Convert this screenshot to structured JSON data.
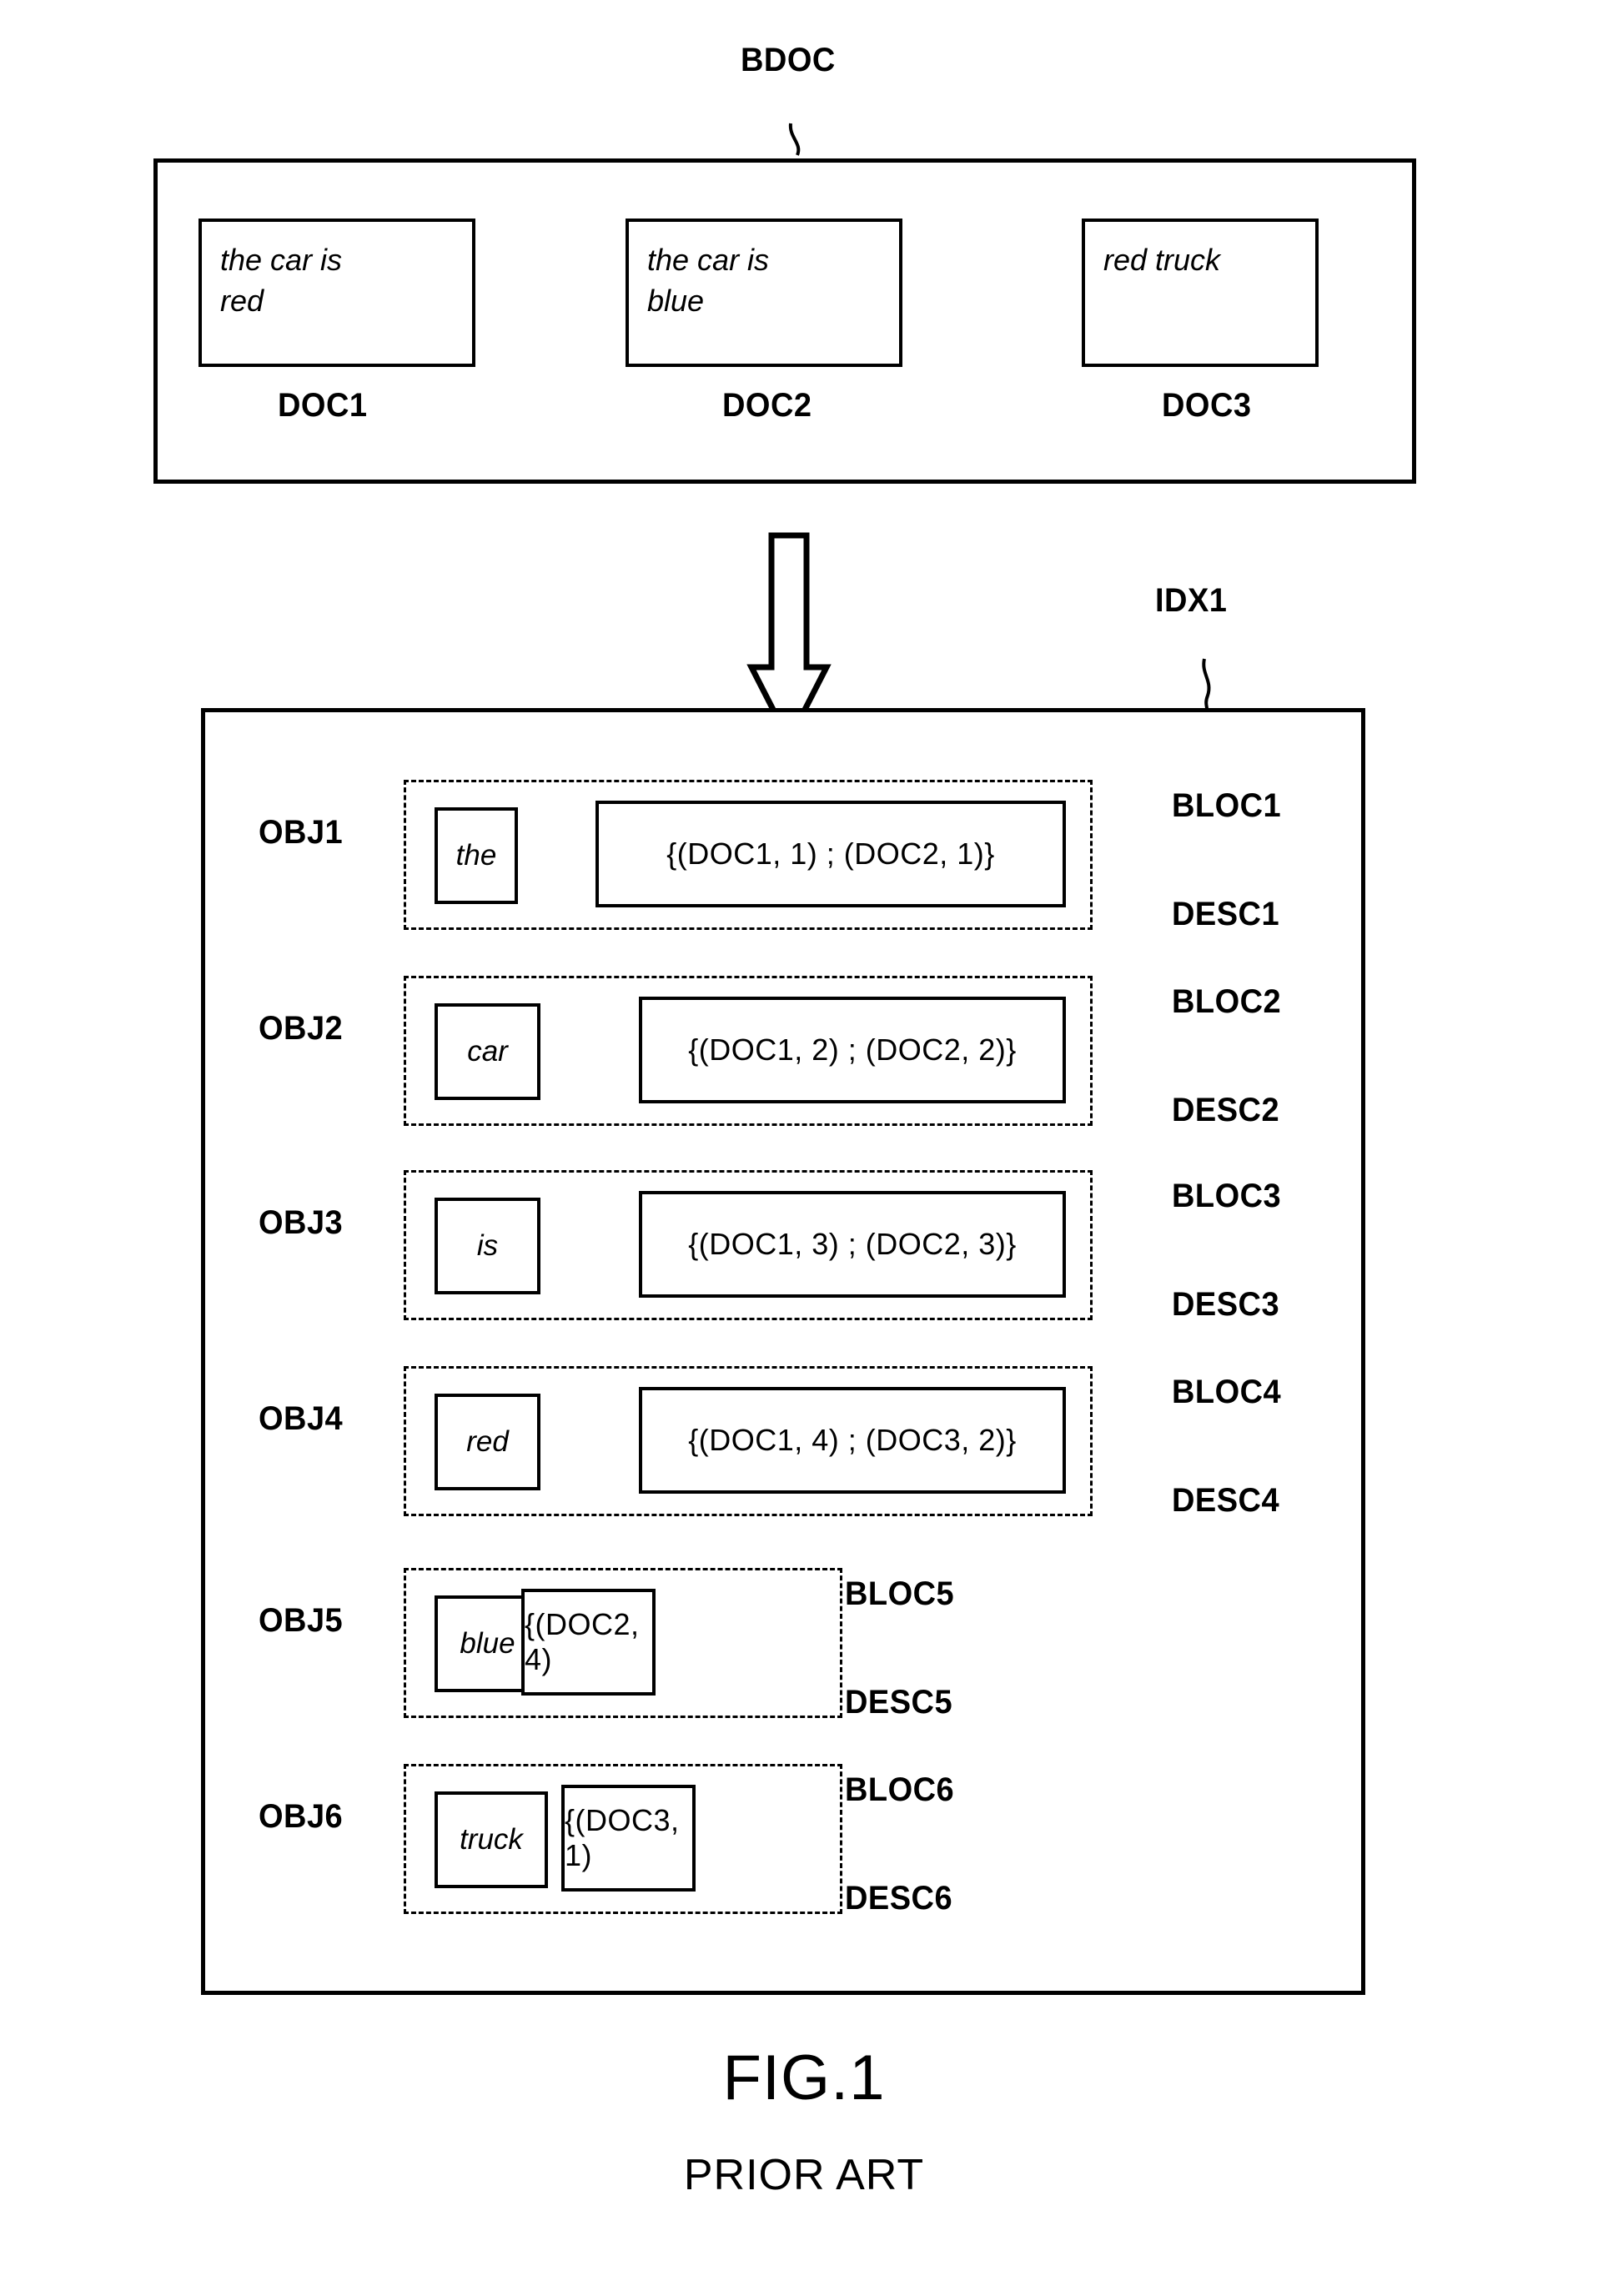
{
  "figure": {
    "caption": "FIG.1",
    "subcaption": "PRIOR ART"
  },
  "corpus": {
    "label": "BDOC",
    "documents": [
      {
        "id_label": "DOC1",
        "lines": [
          "the car is",
          "red"
        ]
      },
      {
        "id_label": "DOC2",
        "lines": [
          "the car is",
          "blue"
        ]
      },
      {
        "id_label": "DOC3",
        "lines": [
          "red truck"
        ]
      }
    ]
  },
  "flow": {
    "arrow_icon": "down-arrow-icon"
  },
  "index": {
    "label": "IDX1",
    "entries": [
      {
        "object_label": "OBJ1",
        "term": "the",
        "posting_list": "{(DOC1, 1) ; (DOC2, 1)}",
        "bloc_label": "BLOC1",
        "desc_label": "DESC1"
      },
      {
        "object_label": "OBJ2",
        "term": "car",
        "posting_list": "{(DOC1, 2) ; (DOC2, 2)}",
        "bloc_label": "BLOC2",
        "desc_label": "DESC2"
      },
      {
        "object_label": "OBJ3",
        "term": "is",
        "posting_list": "{(DOC1, 3) ; (DOC2, 3)}",
        "bloc_label": "BLOC3",
        "desc_label": "DESC3"
      },
      {
        "object_label": "OBJ4",
        "term": "red",
        "posting_list": "{(DOC1, 4) ; (DOC3, 2)}",
        "bloc_label": "BLOC4",
        "desc_label": "DESC4"
      },
      {
        "object_label": "OBJ5",
        "term": "blue",
        "posting_list": "{(DOC2, 4)",
        "bloc_label": "BLOC5",
        "desc_label": "DESC5"
      },
      {
        "object_label": "OBJ6",
        "term": "truck",
        "posting_list": "{(DOC3, 1)",
        "bloc_label": "BLOC6",
        "desc_label": "DESC6"
      }
    ]
  },
  "colors": {
    "ink": "#000000",
    "paper": "#ffffff"
  }
}
